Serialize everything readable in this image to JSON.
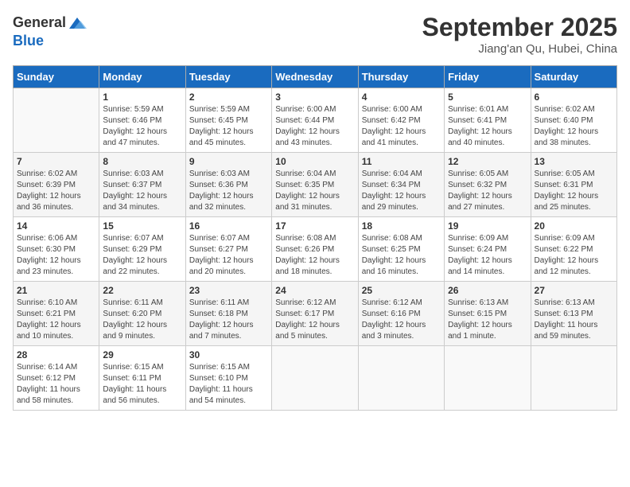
{
  "header": {
    "logo_general": "General",
    "logo_blue": "Blue",
    "month_title": "September 2025",
    "subtitle": "Jiang'an Qu, Hubei, China"
  },
  "weekdays": [
    "Sunday",
    "Monday",
    "Tuesday",
    "Wednesday",
    "Thursday",
    "Friday",
    "Saturday"
  ],
  "weeks": [
    [
      {
        "day": "",
        "info": ""
      },
      {
        "day": "1",
        "info": "Sunrise: 5:59 AM\nSunset: 6:46 PM\nDaylight: 12 hours\nand 47 minutes."
      },
      {
        "day": "2",
        "info": "Sunrise: 5:59 AM\nSunset: 6:45 PM\nDaylight: 12 hours\nand 45 minutes."
      },
      {
        "day": "3",
        "info": "Sunrise: 6:00 AM\nSunset: 6:44 PM\nDaylight: 12 hours\nand 43 minutes."
      },
      {
        "day": "4",
        "info": "Sunrise: 6:00 AM\nSunset: 6:42 PM\nDaylight: 12 hours\nand 41 minutes."
      },
      {
        "day": "5",
        "info": "Sunrise: 6:01 AM\nSunset: 6:41 PM\nDaylight: 12 hours\nand 40 minutes."
      },
      {
        "day": "6",
        "info": "Sunrise: 6:02 AM\nSunset: 6:40 PM\nDaylight: 12 hours\nand 38 minutes."
      }
    ],
    [
      {
        "day": "7",
        "info": "Sunrise: 6:02 AM\nSunset: 6:39 PM\nDaylight: 12 hours\nand 36 minutes."
      },
      {
        "day": "8",
        "info": "Sunrise: 6:03 AM\nSunset: 6:37 PM\nDaylight: 12 hours\nand 34 minutes."
      },
      {
        "day": "9",
        "info": "Sunrise: 6:03 AM\nSunset: 6:36 PM\nDaylight: 12 hours\nand 32 minutes."
      },
      {
        "day": "10",
        "info": "Sunrise: 6:04 AM\nSunset: 6:35 PM\nDaylight: 12 hours\nand 31 minutes."
      },
      {
        "day": "11",
        "info": "Sunrise: 6:04 AM\nSunset: 6:34 PM\nDaylight: 12 hours\nand 29 minutes."
      },
      {
        "day": "12",
        "info": "Sunrise: 6:05 AM\nSunset: 6:32 PM\nDaylight: 12 hours\nand 27 minutes."
      },
      {
        "day": "13",
        "info": "Sunrise: 6:05 AM\nSunset: 6:31 PM\nDaylight: 12 hours\nand 25 minutes."
      }
    ],
    [
      {
        "day": "14",
        "info": "Sunrise: 6:06 AM\nSunset: 6:30 PM\nDaylight: 12 hours\nand 23 minutes."
      },
      {
        "day": "15",
        "info": "Sunrise: 6:07 AM\nSunset: 6:29 PM\nDaylight: 12 hours\nand 22 minutes."
      },
      {
        "day": "16",
        "info": "Sunrise: 6:07 AM\nSunset: 6:27 PM\nDaylight: 12 hours\nand 20 minutes."
      },
      {
        "day": "17",
        "info": "Sunrise: 6:08 AM\nSunset: 6:26 PM\nDaylight: 12 hours\nand 18 minutes."
      },
      {
        "day": "18",
        "info": "Sunrise: 6:08 AM\nSunset: 6:25 PM\nDaylight: 12 hours\nand 16 minutes."
      },
      {
        "day": "19",
        "info": "Sunrise: 6:09 AM\nSunset: 6:24 PM\nDaylight: 12 hours\nand 14 minutes."
      },
      {
        "day": "20",
        "info": "Sunrise: 6:09 AM\nSunset: 6:22 PM\nDaylight: 12 hours\nand 12 minutes."
      }
    ],
    [
      {
        "day": "21",
        "info": "Sunrise: 6:10 AM\nSunset: 6:21 PM\nDaylight: 12 hours\nand 10 minutes."
      },
      {
        "day": "22",
        "info": "Sunrise: 6:11 AM\nSunset: 6:20 PM\nDaylight: 12 hours\nand 9 minutes."
      },
      {
        "day": "23",
        "info": "Sunrise: 6:11 AM\nSunset: 6:18 PM\nDaylight: 12 hours\nand 7 minutes."
      },
      {
        "day": "24",
        "info": "Sunrise: 6:12 AM\nSunset: 6:17 PM\nDaylight: 12 hours\nand 5 minutes."
      },
      {
        "day": "25",
        "info": "Sunrise: 6:12 AM\nSunset: 6:16 PM\nDaylight: 12 hours\nand 3 minutes."
      },
      {
        "day": "26",
        "info": "Sunrise: 6:13 AM\nSunset: 6:15 PM\nDaylight: 12 hours\nand 1 minute."
      },
      {
        "day": "27",
        "info": "Sunrise: 6:13 AM\nSunset: 6:13 PM\nDaylight: 11 hours\nand 59 minutes."
      }
    ],
    [
      {
        "day": "28",
        "info": "Sunrise: 6:14 AM\nSunset: 6:12 PM\nDaylight: 11 hours\nand 58 minutes."
      },
      {
        "day": "29",
        "info": "Sunrise: 6:15 AM\nSunset: 6:11 PM\nDaylight: 11 hours\nand 56 minutes."
      },
      {
        "day": "30",
        "info": "Sunrise: 6:15 AM\nSunset: 6:10 PM\nDaylight: 11 hours\nand 54 minutes."
      },
      {
        "day": "",
        "info": ""
      },
      {
        "day": "",
        "info": ""
      },
      {
        "day": "",
        "info": ""
      },
      {
        "day": "",
        "info": ""
      }
    ]
  ]
}
